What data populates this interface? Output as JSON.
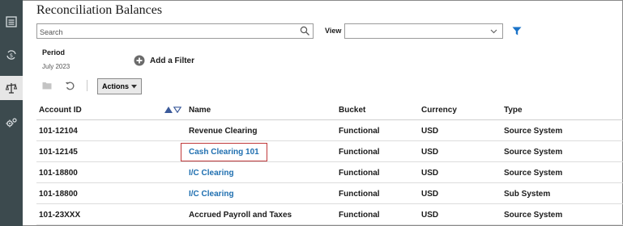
{
  "page_title": "Reconciliation Balances",
  "search": {
    "placeholder": "Search"
  },
  "view": {
    "label": "View",
    "value": ""
  },
  "period": {
    "label": "Period",
    "value": "July 2023"
  },
  "add_filter_label": "Add a Filter",
  "actions_label": "Actions",
  "rail_icons": [
    "dashboard-icon",
    "transactions-icon",
    "balances-icon",
    "settings-icon"
  ],
  "colors": {
    "rail": "#3c4a4e",
    "link": "#1f6fb0",
    "highlight": "#c0393b",
    "filter": "#1a73c8"
  },
  "table": {
    "columns": [
      "Account ID",
      "Name",
      "Bucket",
      "Currency",
      "Type"
    ],
    "rows": [
      {
        "account_id": "101-12104",
        "name": "Revenue Clearing",
        "bucket": "Functional",
        "currency": "USD",
        "type": "Source System"
      },
      {
        "account_id": "101-12145",
        "name": "Cash Clearing 101",
        "bucket": "Functional",
        "currency": "USD",
        "type": "Source System"
      },
      {
        "account_id": "101-18800",
        "name": "I/C Clearing",
        "bucket": "Functional",
        "currency": "USD",
        "type": "Source System"
      },
      {
        "account_id": "101-18800",
        "name": "I/C Clearing",
        "bucket": "Functional",
        "currency": "USD",
        "type": "Sub System"
      },
      {
        "account_id": "101-23XXX",
        "name": "Accrued Payroll and Taxes",
        "bucket": "Functional",
        "currency": "USD",
        "type": "Source System"
      }
    ]
  }
}
